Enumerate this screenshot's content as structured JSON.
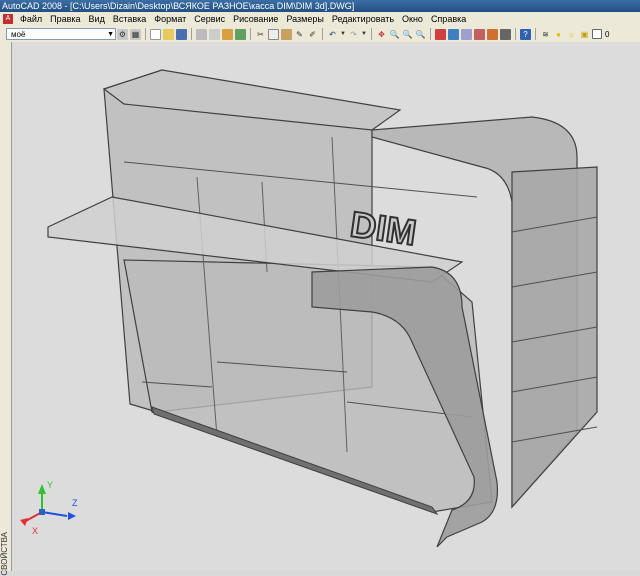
{
  "window": {
    "title": "AutoCAD 2008 - [C:\\Users\\Dizain\\Desktop\\ВСЯКОЕ РАЗНОЕ\\касса DIM\\DIM 3d].DWG]"
  },
  "menu": {
    "items": [
      "Файл",
      "Правка",
      "Вид",
      "Вставка",
      "Формат",
      "Сервис",
      "Рисование",
      "Размеры",
      "Редактировать",
      "Окно",
      "Справка"
    ]
  },
  "toolbar": {
    "workspace_value": "моё",
    "layer_value": "0"
  },
  "left_panel": {
    "label": "СВОЙСТВА"
  },
  "model": {
    "logo_text": "DIM"
  },
  "ucs": {
    "x_label": "X",
    "y_label": "Y",
    "z_label": "Z",
    "x_color": "#e03030",
    "y_color": "#30c030",
    "z_color": "#2050e0"
  }
}
